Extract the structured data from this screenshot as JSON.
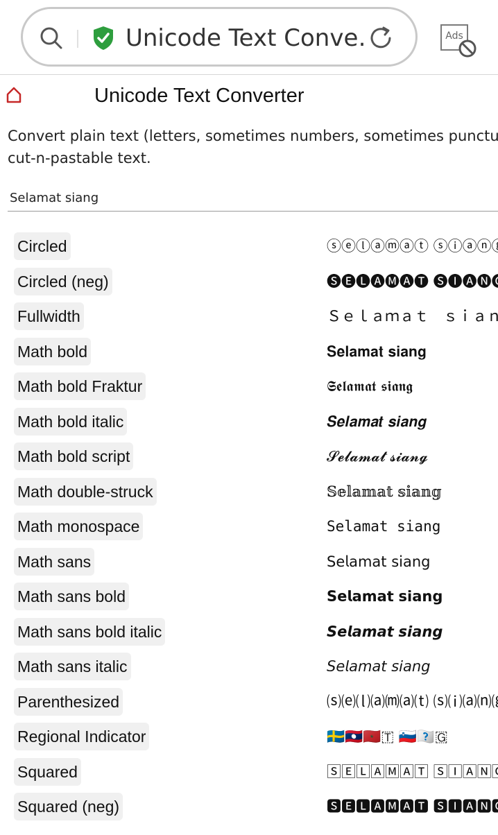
{
  "browser": {
    "url_text": "Unicode Text Conve…",
    "ads_label": "Ads"
  },
  "site": {
    "title": "Unicode Text Converter"
  },
  "intro": {
    "line1": "Convert plain text (letters, sometimes numbers, sometimes punctu",
    "line2": "cut-n-pastable text."
  },
  "input": {
    "value": "Selamat siang"
  },
  "results": [
    {
      "name": "Circled",
      "text": "ⓢⓔⓛⓐⓜⓐⓣ ⓢⓘⓐⓝⓖ",
      "font": "sans"
    },
    {
      "name": "Circled (neg)",
      "text": "🅢🅔🅛🅐🅜🅐🅣 🅢🅘🅐🅝🅖",
      "font": "sans"
    },
    {
      "name": "Fullwidth",
      "text": "Ｓｅｌａｍａｔ　ｓｉａｎｇ",
      "font": "sans"
    },
    {
      "name": "Math bold",
      "text": "𝐒𝐞𝐥𝐚𝐦𝐚𝐭 𝐬𝐢𝐚𝐧𝐠",
      "font": "serif"
    },
    {
      "name": "Math bold Fraktur",
      "text": "𝕾𝖊𝖑𝖆𝖒𝖆𝖙 𝖘𝖎𝖆𝖓𝖌",
      "font": "serif"
    },
    {
      "name": "Math bold italic",
      "text": "𝑺𝒆𝒍𝒂𝒎𝒂𝒕 𝒔𝒊𝒂𝒏𝒈",
      "font": "serif"
    },
    {
      "name": "Math bold script",
      "text": "𝓢𝓮𝓵𝓪𝓶𝓪𝓽 𝓼𝓲𝓪𝓷𝓰",
      "font": "serif"
    },
    {
      "name": "Math double-struck",
      "text": "𝕊𝕖𝕝𝕒𝕞𝕒𝕥 𝕤𝕚𝕒𝕟𝕘",
      "font": "serif"
    },
    {
      "name": "Math monospace",
      "text": "𝚂𝚎𝚕𝚊𝚖𝚊𝚝 𝚜𝚒𝚊𝚗𝚐",
      "font": "mono"
    },
    {
      "name": "Math sans",
      "text": "𝖲𝖾𝗅𝖺𝗆𝖺𝗍 𝗌𝗂𝖺𝗇𝗀",
      "font": "sans"
    },
    {
      "name": "Math sans bold",
      "text": "𝗦𝗲𝗹𝗮𝗺𝗮𝘁 𝘀𝗶𝗮𝗻𝗴",
      "font": "sans"
    },
    {
      "name": "Math sans bold italic",
      "text": "𝙎𝙚𝙡𝙖𝙢𝙖𝙩 𝙨𝙞𝙖𝙣𝙜",
      "font": "sans"
    },
    {
      "name": "Math sans italic",
      "text": "𝘚𝘦𝘭𝘢𝘮𝘢𝘵 𝘴𝘪𝘢𝘯𝘨",
      "font": "sans"
    },
    {
      "name": "Parenthesized",
      "text": "⒮⒠⒧⒜⒨⒜⒯ ⒮⒤⒜⒩⒢",
      "font": "sans"
    },
    {
      "name": "Regional Indicator",
      "text": "🇸🇪🇱🇦🇲🇦🇹 🇸🇮🇦🇳🇬",
      "font": "sans"
    },
    {
      "name": "Squared",
      "text": "🅂🄴🄻🄰🄼🄰🅃 🅂🄸🄰🄽🄶",
      "font": "sans"
    },
    {
      "name": "Squared (neg)",
      "text": "🆂🅴🅻🅰🅼🅰🆃 🆂🅸🅰🅽🅶",
      "font": "sans"
    }
  ],
  "colors": {
    "home_icon": "#c62828",
    "shield": "#2e9e3e",
    "name_chip_bg": "#f0f0f0"
  },
  "icons": {
    "search": "search-icon",
    "secure": "shield-check-icon",
    "reload": "reload-icon",
    "ads_block": "ads-blocked-icon",
    "home": "home-icon"
  }
}
